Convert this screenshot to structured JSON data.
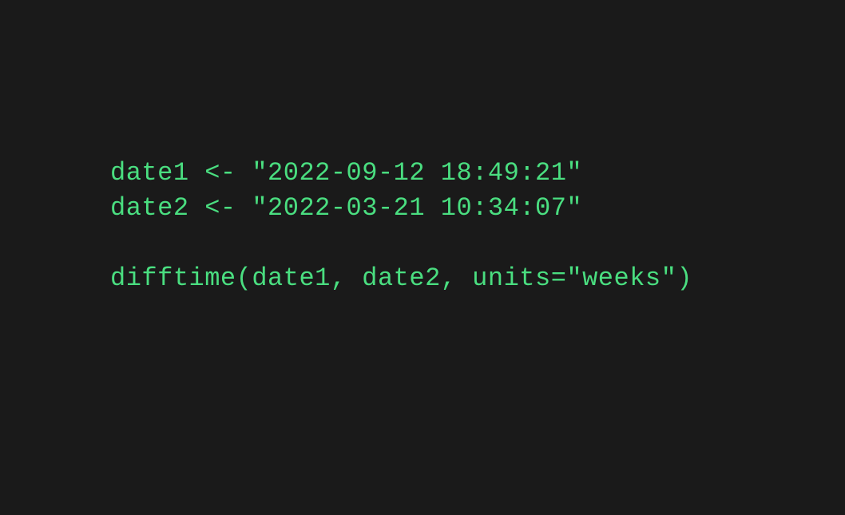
{
  "code": {
    "line1": "date1 <- \"2022-09-12 18:49:21\"",
    "line2": "date2 <- \"2022-03-21 10:34:07\"",
    "line3": "",
    "line4": "difftime(date1, date2, units=\"weeks\")"
  }
}
